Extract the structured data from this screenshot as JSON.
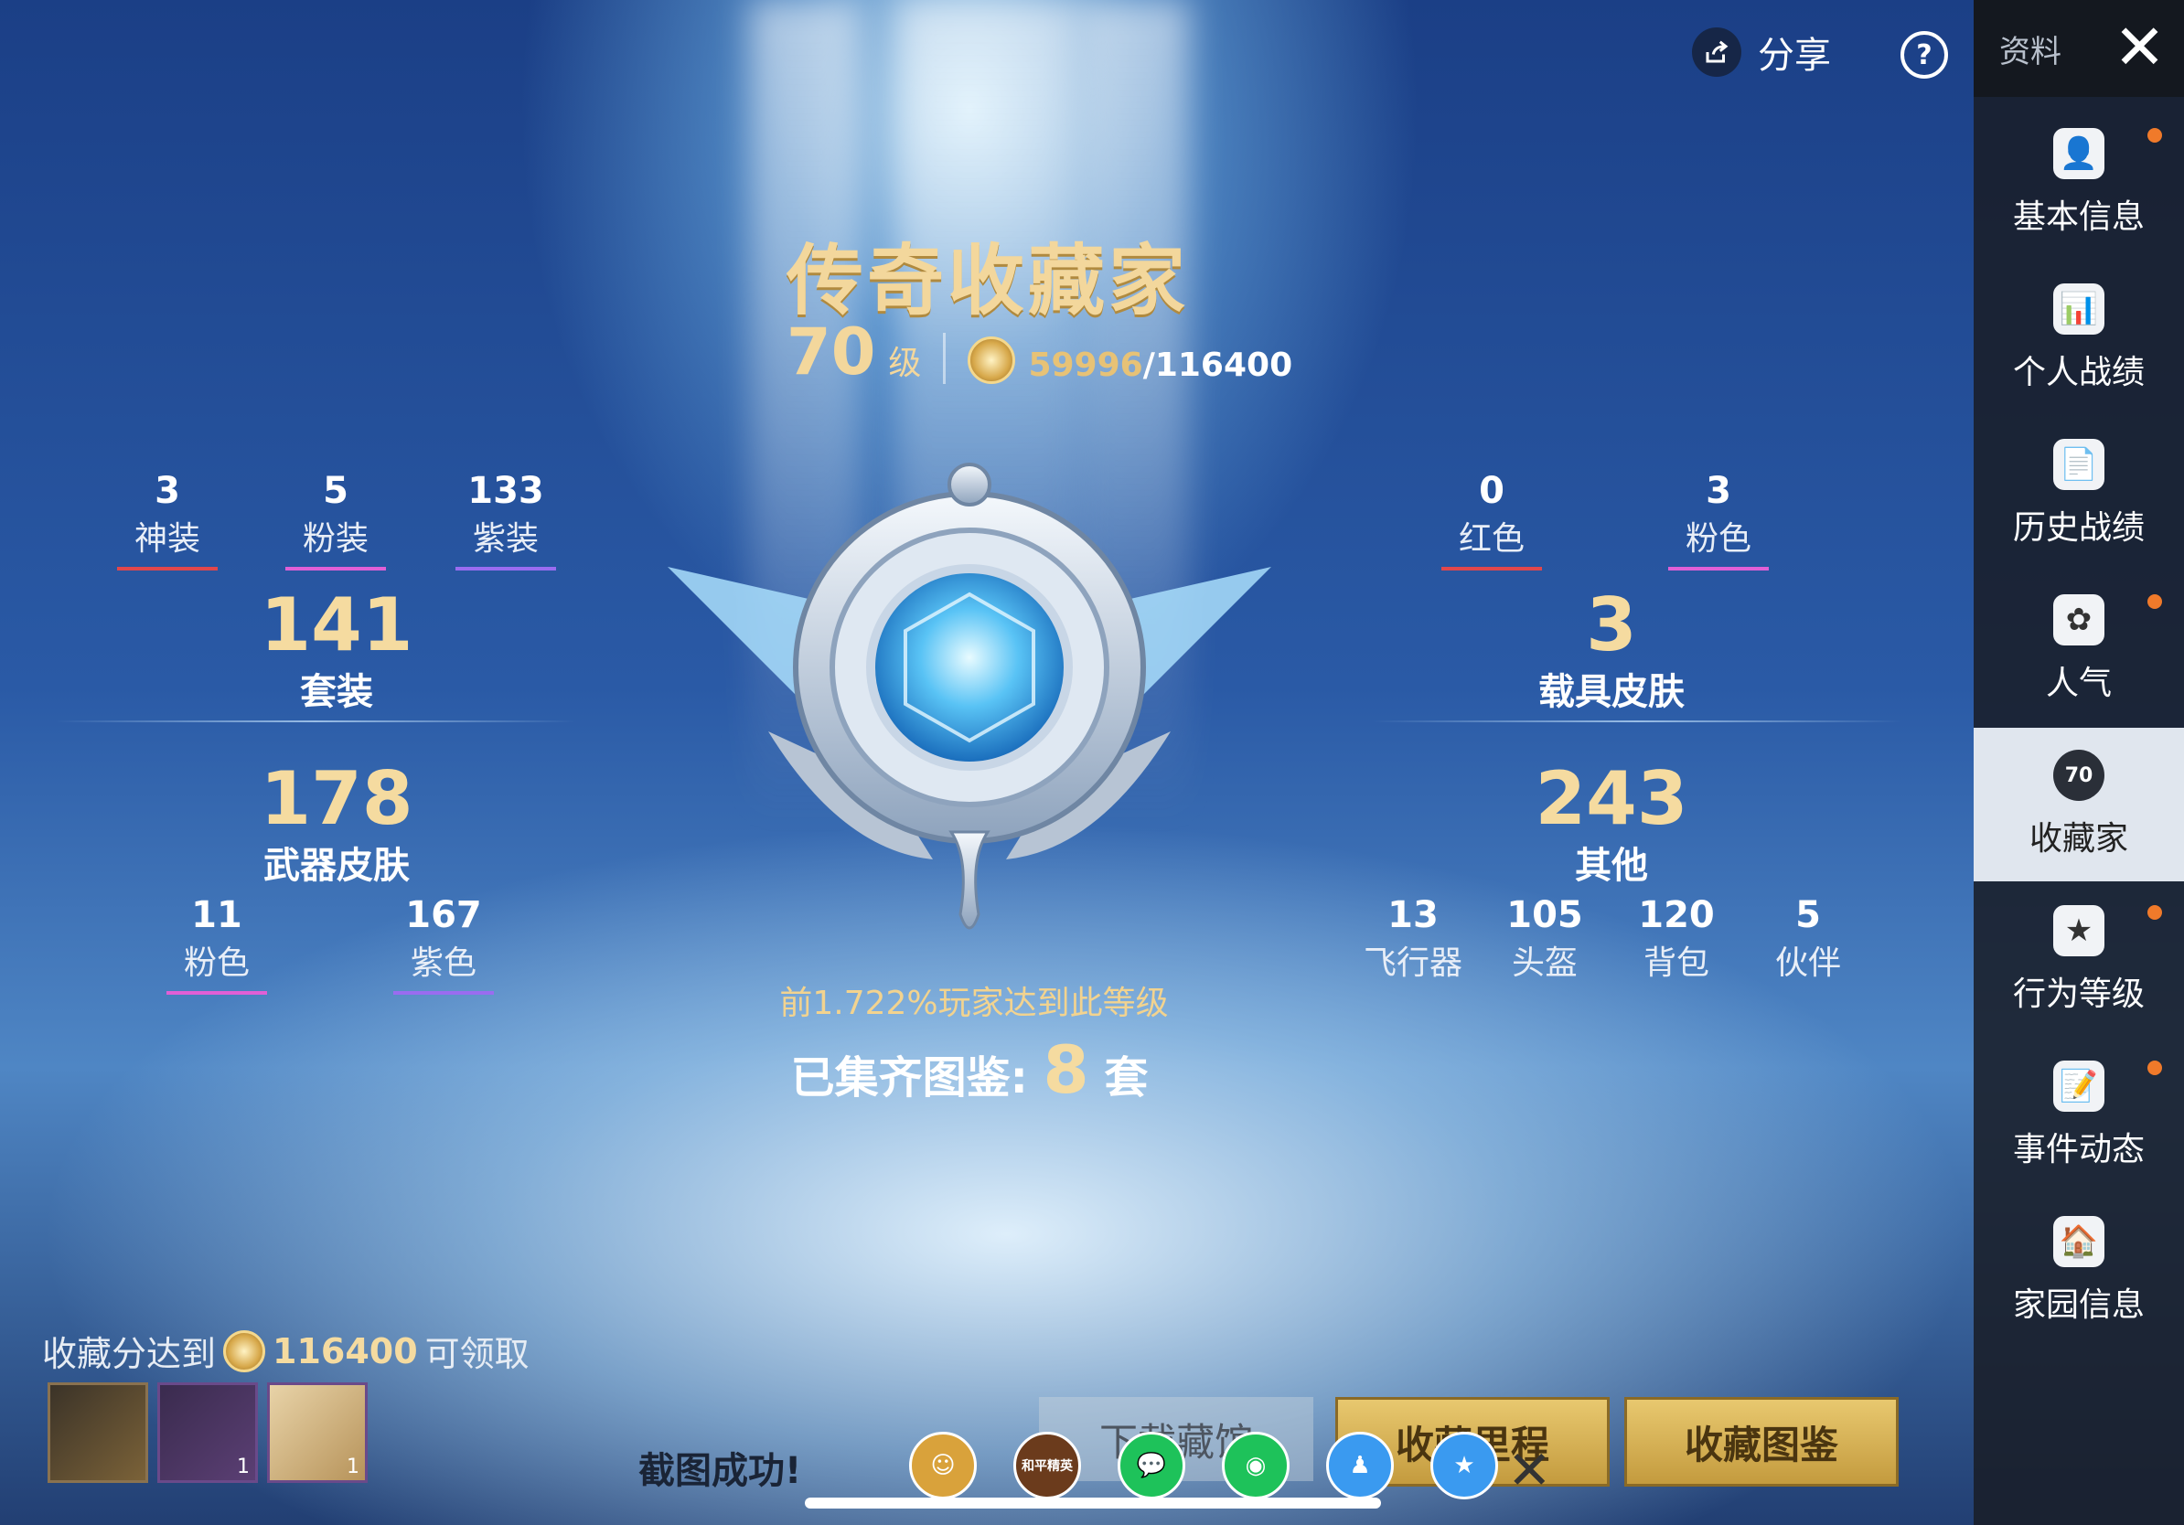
{
  "topbar": {
    "share_label": "分享",
    "help_symbol": "?"
  },
  "sidebar": {
    "header_label": "资料",
    "close_symbol": "✕",
    "items": [
      {
        "label": "基本信息",
        "icon": "user-profile-icon",
        "glyph": "👤",
        "dot": true
      },
      {
        "label": "个人战绩",
        "icon": "stats-chart-icon",
        "glyph": "📊",
        "dot": false
      },
      {
        "label": "历史战绩",
        "icon": "history-doc-icon",
        "glyph": "📄",
        "dot": false
      },
      {
        "label": "人气",
        "icon": "flower-icon",
        "glyph": "✿",
        "dot": true
      },
      {
        "label": "收藏家",
        "icon": "collector-badge-icon",
        "glyph": "70",
        "dot": false,
        "active": true
      },
      {
        "label": "行为等级",
        "icon": "behavior-star-icon",
        "glyph": "★",
        "dot": true
      },
      {
        "label": "事件动态",
        "icon": "event-doc-icon",
        "glyph": "📝",
        "dot": true
      },
      {
        "label": "家园信息",
        "icon": "home-icon",
        "glyph": "🏠",
        "dot": false
      }
    ]
  },
  "main": {
    "title": "传奇收藏家",
    "level": "70",
    "level_unit": "级",
    "score_current": "59996",
    "score_max": "/116400",
    "rank_text": "前1.722%玩家达到此等级",
    "collected_prefix": "已集齐图鉴:",
    "collected_count": "8",
    "collected_suffix": "套"
  },
  "stats": {
    "outfit_top": [
      {
        "value": "3",
        "label": "神装",
        "color": "#e2474b"
      },
      {
        "value": "5",
        "label": "粉装",
        "color": "#e05fd6"
      },
      {
        "value": "133",
        "label": "紫装",
        "color": "#9a6cf0"
      }
    ],
    "outfit_total": {
      "value": "141",
      "label": "套装"
    },
    "vehicle_top": [
      {
        "value": "0",
        "label": "红色",
        "color": "#e2474b"
      },
      {
        "value": "3",
        "label": "粉色",
        "color": "#e05fd6"
      }
    ],
    "vehicle_total": {
      "value": "3",
      "label": "载具皮肤"
    },
    "weapon_total": {
      "value": "178",
      "label": "武器皮肤"
    },
    "weapon_sub": [
      {
        "value": "11",
        "label": "粉色",
        "color": "#e05fd6"
      },
      {
        "value": "167",
        "label": "紫色",
        "color": "#9a6cf0"
      }
    ],
    "other_total": {
      "value": "243",
      "label": "其他"
    },
    "other_sub": [
      {
        "value": "13",
        "label": "飞行器"
      },
      {
        "value": "105",
        "label": "头盔"
      },
      {
        "value": "120",
        "label": "背包"
      },
      {
        "value": "5",
        "label": "伙伴"
      }
    ]
  },
  "reward": {
    "prefix": "收藏分达到",
    "value": "116400",
    "suffix": "可领取",
    "items": [
      {
        "count": ""
      },
      {
        "count": "1"
      },
      {
        "count": "1"
      }
    ]
  },
  "buttons": {
    "download": "下载藏馆",
    "milestone": "收藏里程",
    "album": "收藏图鉴"
  },
  "share_overlay": {
    "toast": "截图成功!",
    "targets": [
      {
        "icon": "game-friend-icon",
        "glyph": "☺",
        "color": "#d9a23b"
      },
      {
        "icon": "peace-elite-icon",
        "glyph": "和平精英",
        "color": "#6b3b1c"
      },
      {
        "icon": "wechat-icon",
        "glyph": "💬",
        "color": "#1ec25a"
      },
      {
        "icon": "moments-icon",
        "glyph": "◉",
        "color": "#1ec25a"
      },
      {
        "icon": "qq-icon",
        "glyph": "♟",
        "color": "#3a9af0"
      },
      {
        "icon": "qzone-icon",
        "glyph": "★",
        "color": "#3a9af0"
      }
    ],
    "close_symbol": "✕"
  }
}
